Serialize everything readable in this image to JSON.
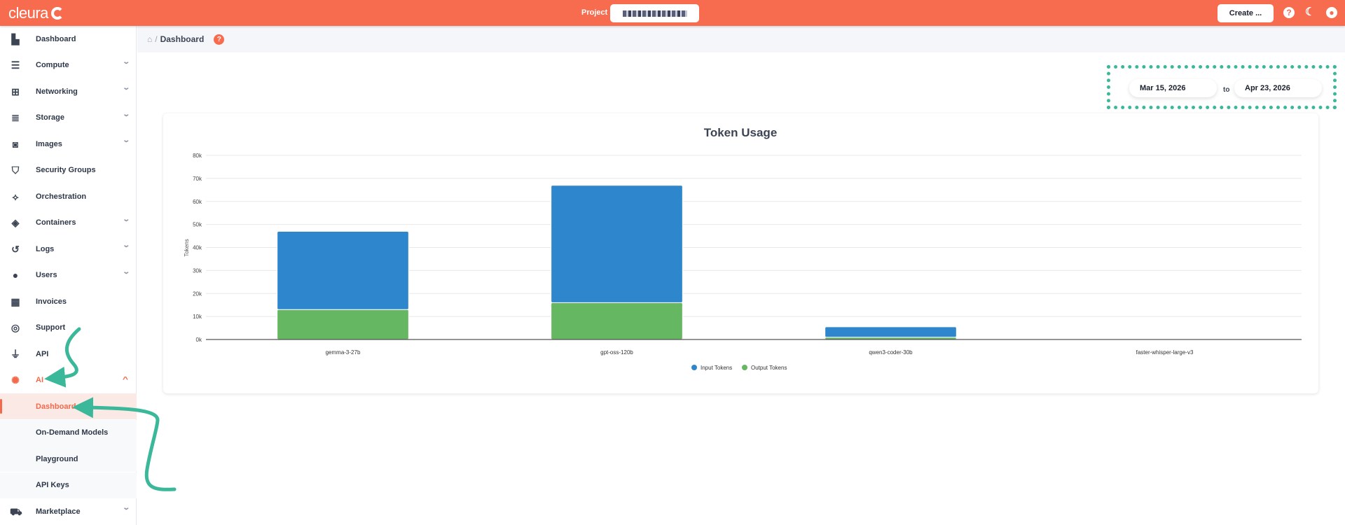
{
  "header": {
    "logo": "cleura",
    "project_label": "Project",
    "create_label": "Create ...",
    "icons": [
      "help-icon",
      "moon-icon",
      "user-icon"
    ]
  },
  "breadcrumb": {
    "current": "Dashboard"
  },
  "sidebar": {
    "items": [
      {
        "label": "Dashboard",
        "icon": "chart-area-icon",
        "chev": ""
      },
      {
        "label": "Compute",
        "icon": "server-icon",
        "chev": "v"
      },
      {
        "label": "Networking",
        "icon": "sitemap-icon",
        "chev": "v"
      },
      {
        "label": "Storage",
        "icon": "database-icon",
        "chev": "v"
      },
      {
        "label": "Images",
        "icon": "camera-icon",
        "chev": "v"
      },
      {
        "label": "Security Groups",
        "icon": "shield-icon",
        "chev": ""
      },
      {
        "label": "Orchestration",
        "icon": "orchestration-icon",
        "chev": ""
      },
      {
        "label": "Containers",
        "icon": "cube-icon",
        "chev": "v"
      },
      {
        "label": "Logs",
        "icon": "history-icon",
        "chev": "v"
      },
      {
        "label": "Users",
        "icon": "user-icon",
        "chev": "v"
      },
      {
        "label": "Invoices",
        "icon": "calculator-icon",
        "chev": ""
      },
      {
        "label": "Support",
        "icon": "life-ring-icon",
        "chev": ""
      },
      {
        "label": "API",
        "icon": "plug-icon",
        "chev": ""
      },
      {
        "label": "AI",
        "icon": "brain-icon",
        "chev": "^"
      }
    ],
    "ai_sub": [
      {
        "label": "Dashboard",
        "active": true
      },
      {
        "label": "On-Demand Models"
      },
      {
        "label": "Playground"
      },
      {
        "label": "API Keys"
      }
    ],
    "after": {
      "label": "Marketplace",
      "icon": "cart-icon",
      "chev": "v"
    }
  },
  "dates": {
    "from": "Mar 15, 2026",
    "sep": "to",
    "to": "Apr 23, 2026"
  },
  "colors": {
    "brand": "#f76b4e",
    "input": "#2e86cc",
    "output": "#66b762",
    "annotation": "#3bb89a"
  },
  "chart_data": {
    "type": "bar",
    "stacked": true,
    "title": "Token Usage",
    "xlabel": "",
    "ylabel": "Tokens",
    "categories": [
      "gemma-3-27b",
      "gpt-oss-120b",
      "qwen3-coder-30b",
      "faster-whisper-large-v3"
    ],
    "ylim": [
      0,
      80000
    ],
    "yticks": [
      "0k",
      "10k",
      "20k",
      "30k",
      "40k",
      "50k",
      "60k",
      "70k",
      "80k"
    ],
    "series": [
      {
        "name": "Output Tokens",
        "color": "#66b762",
        "values": [
          13000,
          16000,
          1000,
          0
        ]
      },
      {
        "name": "Input Tokens",
        "color": "#2e86cc",
        "values": [
          34000,
          51000,
          4500,
          0
        ]
      }
    ],
    "legend": [
      "Input Tokens",
      "Output Tokens"
    ],
    "legend_position": "bottom",
    "grid": true
  }
}
